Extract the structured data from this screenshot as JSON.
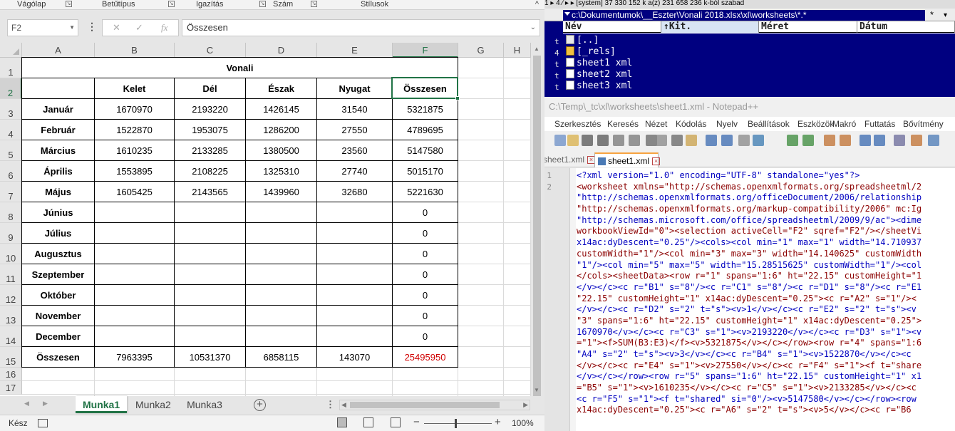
{
  "excel": {
    "ribbon_groups": [
      "Vágólap",
      "Betűtípus",
      "Igazítás",
      "Szám",
      "Stílusok"
    ],
    "ribbon_collapse": "^",
    "name_box": "F2",
    "formula_icons": {
      "cancel": "✕",
      "enter": "✓",
      "fx": "fx"
    },
    "formula_bar_value": "Összesen",
    "columns": [
      "A",
      "B",
      "C",
      "D",
      "E",
      "F",
      "G",
      "H"
    ],
    "selected_column": "F",
    "rows": [
      "1",
      "2",
      "3",
      "4",
      "5",
      "6",
      "7",
      "8",
      "9",
      "10",
      "11",
      "12",
      "13",
      "14",
      "15",
      "16",
      "17"
    ],
    "selected_row": "2",
    "table": {
      "title": "Vonali",
      "headers": [
        "Kelet",
        "Dél",
        "Észak",
        "Nyugat",
        "Összesen"
      ],
      "months": [
        "Január",
        "Február",
        "Március",
        "Április",
        "Május",
        "Június",
        "Július",
        "Augusztus",
        "Szeptember",
        "Október",
        "November",
        "December"
      ],
      "data": [
        [
          "1670970",
          "2193220",
          "1426145",
          "31540",
          "5321875"
        ],
        [
          "1522870",
          "1953075",
          "1286200",
          "27550",
          "4789695"
        ],
        [
          "1610235",
          "2133285",
          "1380500",
          "23560",
          "5147580"
        ],
        [
          "1553895",
          "2108225",
          "1325310",
          "27740",
          "5015170"
        ],
        [
          "1605425",
          "2143565",
          "1439960",
          "32680",
          "5221630"
        ],
        [
          "",
          "",
          "",
          "",
          "0"
        ],
        [
          "",
          "",
          "",
          "",
          "0"
        ],
        [
          "",
          "",
          "",
          "",
          "0"
        ],
        [
          "",
          "",
          "",
          "",
          "0"
        ],
        [
          "",
          "",
          "",
          "",
          "0"
        ],
        [
          "",
          "",
          "",
          "",
          "0"
        ],
        [
          "",
          "",
          "",
          "",
          "0"
        ]
      ],
      "total_label": "Összesen",
      "totals": [
        "7963395",
        "10531370",
        "6858115",
        "143070",
        "25495950"
      ]
    },
    "sheet_tabs": [
      "Munka1",
      "Munka2",
      "Munka3"
    ],
    "active_sheet": "Munka1",
    "status_ready": "Kész",
    "zoom_level": "100%",
    "accent_color": "#217346",
    "grand_total_color": "#d00000"
  },
  "total_commander": {
    "top_strip": "1 ▸ 4    ∕ ▸ ▸     [system]  37 330 152 k a(z) 231 658 236 k-ból szabad",
    "path": "c:\\Dokumentumok\\__Eszter\\Vonali 2018.xlsx\\xl\\worksheets\\*.*",
    "star": "*",
    "dropdown": "▾",
    "columns": [
      "Név",
      "↑Kit.",
      "Méret",
      "Dátum"
    ],
    "left_panel_chars": [
      "t",
      "4",
      "t",
      "t",
      "t"
    ],
    "items": [
      {
        "name": "[..]",
        "icon": "up-icon"
      },
      {
        "name": "[_rels]",
        "icon": "folder-icon"
      },
      {
        "name": "sheet1 xml",
        "icon": "file-icon"
      },
      {
        "name": "sheet2 xml",
        "icon": "file-icon"
      },
      {
        "name": "sheet3 xml",
        "icon": "file-icon"
      }
    ],
    "panel_color": "#000080"
  },
  "notepadpp": {
    "title": "C:\\Temp\\_tc\\xl\\worksheets\\sheet1.xml - Notepad++",
    "menu": [
      "Szerkesztés",
      "Keresés",
      "Nézet",
      "Kódolás",
      "Nyelv",
      "Beállítások",
      "Eszközök",
      "Makró",
      "Futtatás",
      "Bővítmény"
    ],
    "tabs": [
      "sheet1.xml",
      "sheet1.xml"
    ],
    "line_numbers": [
      "1",
      "2"
    ],
    "code_lines": [
      "<?xml version=\"1.0\" encoding=\"UTF-8\" standalone=\"yes\"?>",
      "<worksheet xmlns=\"http://schemas.openxmlformats.org/spreadsheetml/2",
      "\"http://schemas.openxmlformats.org/officeDocument/2006/relationship",
      "\"http://schemas.openxmlformats.org/markup-compatibility/2006\" mc:Ig",
      "\"http://schemas.microsoft.com/office/spreadsheetml/2009/9/ac\"><dime",
      "workbookViewId=\"0\"><selection activeCell=\"F2\" sqref=\"F2\"/></sheetVi",
      "x14ac:dyDescent=\"0.25\"/><cols><col min=\"1\" max=\"1\" width=\"14.710937",
      "customWidth=\"1\"/><col min=\"3\" max=\"3\" width=\"14.140625\" customWidth",
      "\"1\"/><col min=\"5\" max=\"5\" width=\"15.28515625\" customWidth=\"1\"/><col",
      "</cols><sheetData><row r=\"1\" spans=\"1:6\" ht=\"22.15\" customHeight=\"1",
      "</v></c><c r=\"B1\" s=\"8\"/><c r=\"C1\" s=\"8\"/><c r=\"D1\" s=\"8\"/><c r=\"E1",
      "\"22.15\" customHeight=\"1\" x14ac:dyDescent=\"0.25\"><c r=\"A2\" s=\"1\"/><",
      "</v></c><c r=\"D2\" s=\"2\" t=\"s\"><v>1</v></c><c r=\"E2\" s=\"2\" t=\"s\"><v",
      "\"3\" spans=\"1:6\" ht=\"22.15\" customHeight=\"1\" x14ac:dyDescent=\"0.25\">",
      "1670970</v></c><c r=\"C3\" s=\"1\"><v>2193220</v></c><c r=\"D3\" s=\"1\"><v",
      "=\"1\"><f>SUM(B3:E3)</f><v>5321875</v></c></row><row r=\"4\" spans=\"1:6",
      "\"A4\" s=\"2\" t=\"s\"><v>3</v></c><c r=\"B4\" s=\"1\"><v>1522870</v></c><c",
      "</v></c><c r=\"E4\" s=\"1\"><v>27550</v></c><c r=\"F4\" s=\"1\"><f t=\"share",
      "</v></c></row><row r=\"5\" spans=\"1:6\" ht=\"22.15\" customHeight=\"1\" x1",
      "=\"B5\" s=\"1\"><v>1610235</v></c><c r=\"C5\" s=\"1\"><v>2133285</v></c><c",
      "<c r=\"F5\" s=\"1\"><f t=\"shared\" si=\"0\"/><v>5147580</v></c></row><row",
      "x14ac:dyDescent=\"0.25\"><c r=\"A6\" s=\"2\" t=\"s\"><v>5</v></c><c r=\"B6"
    ]
  }
}
